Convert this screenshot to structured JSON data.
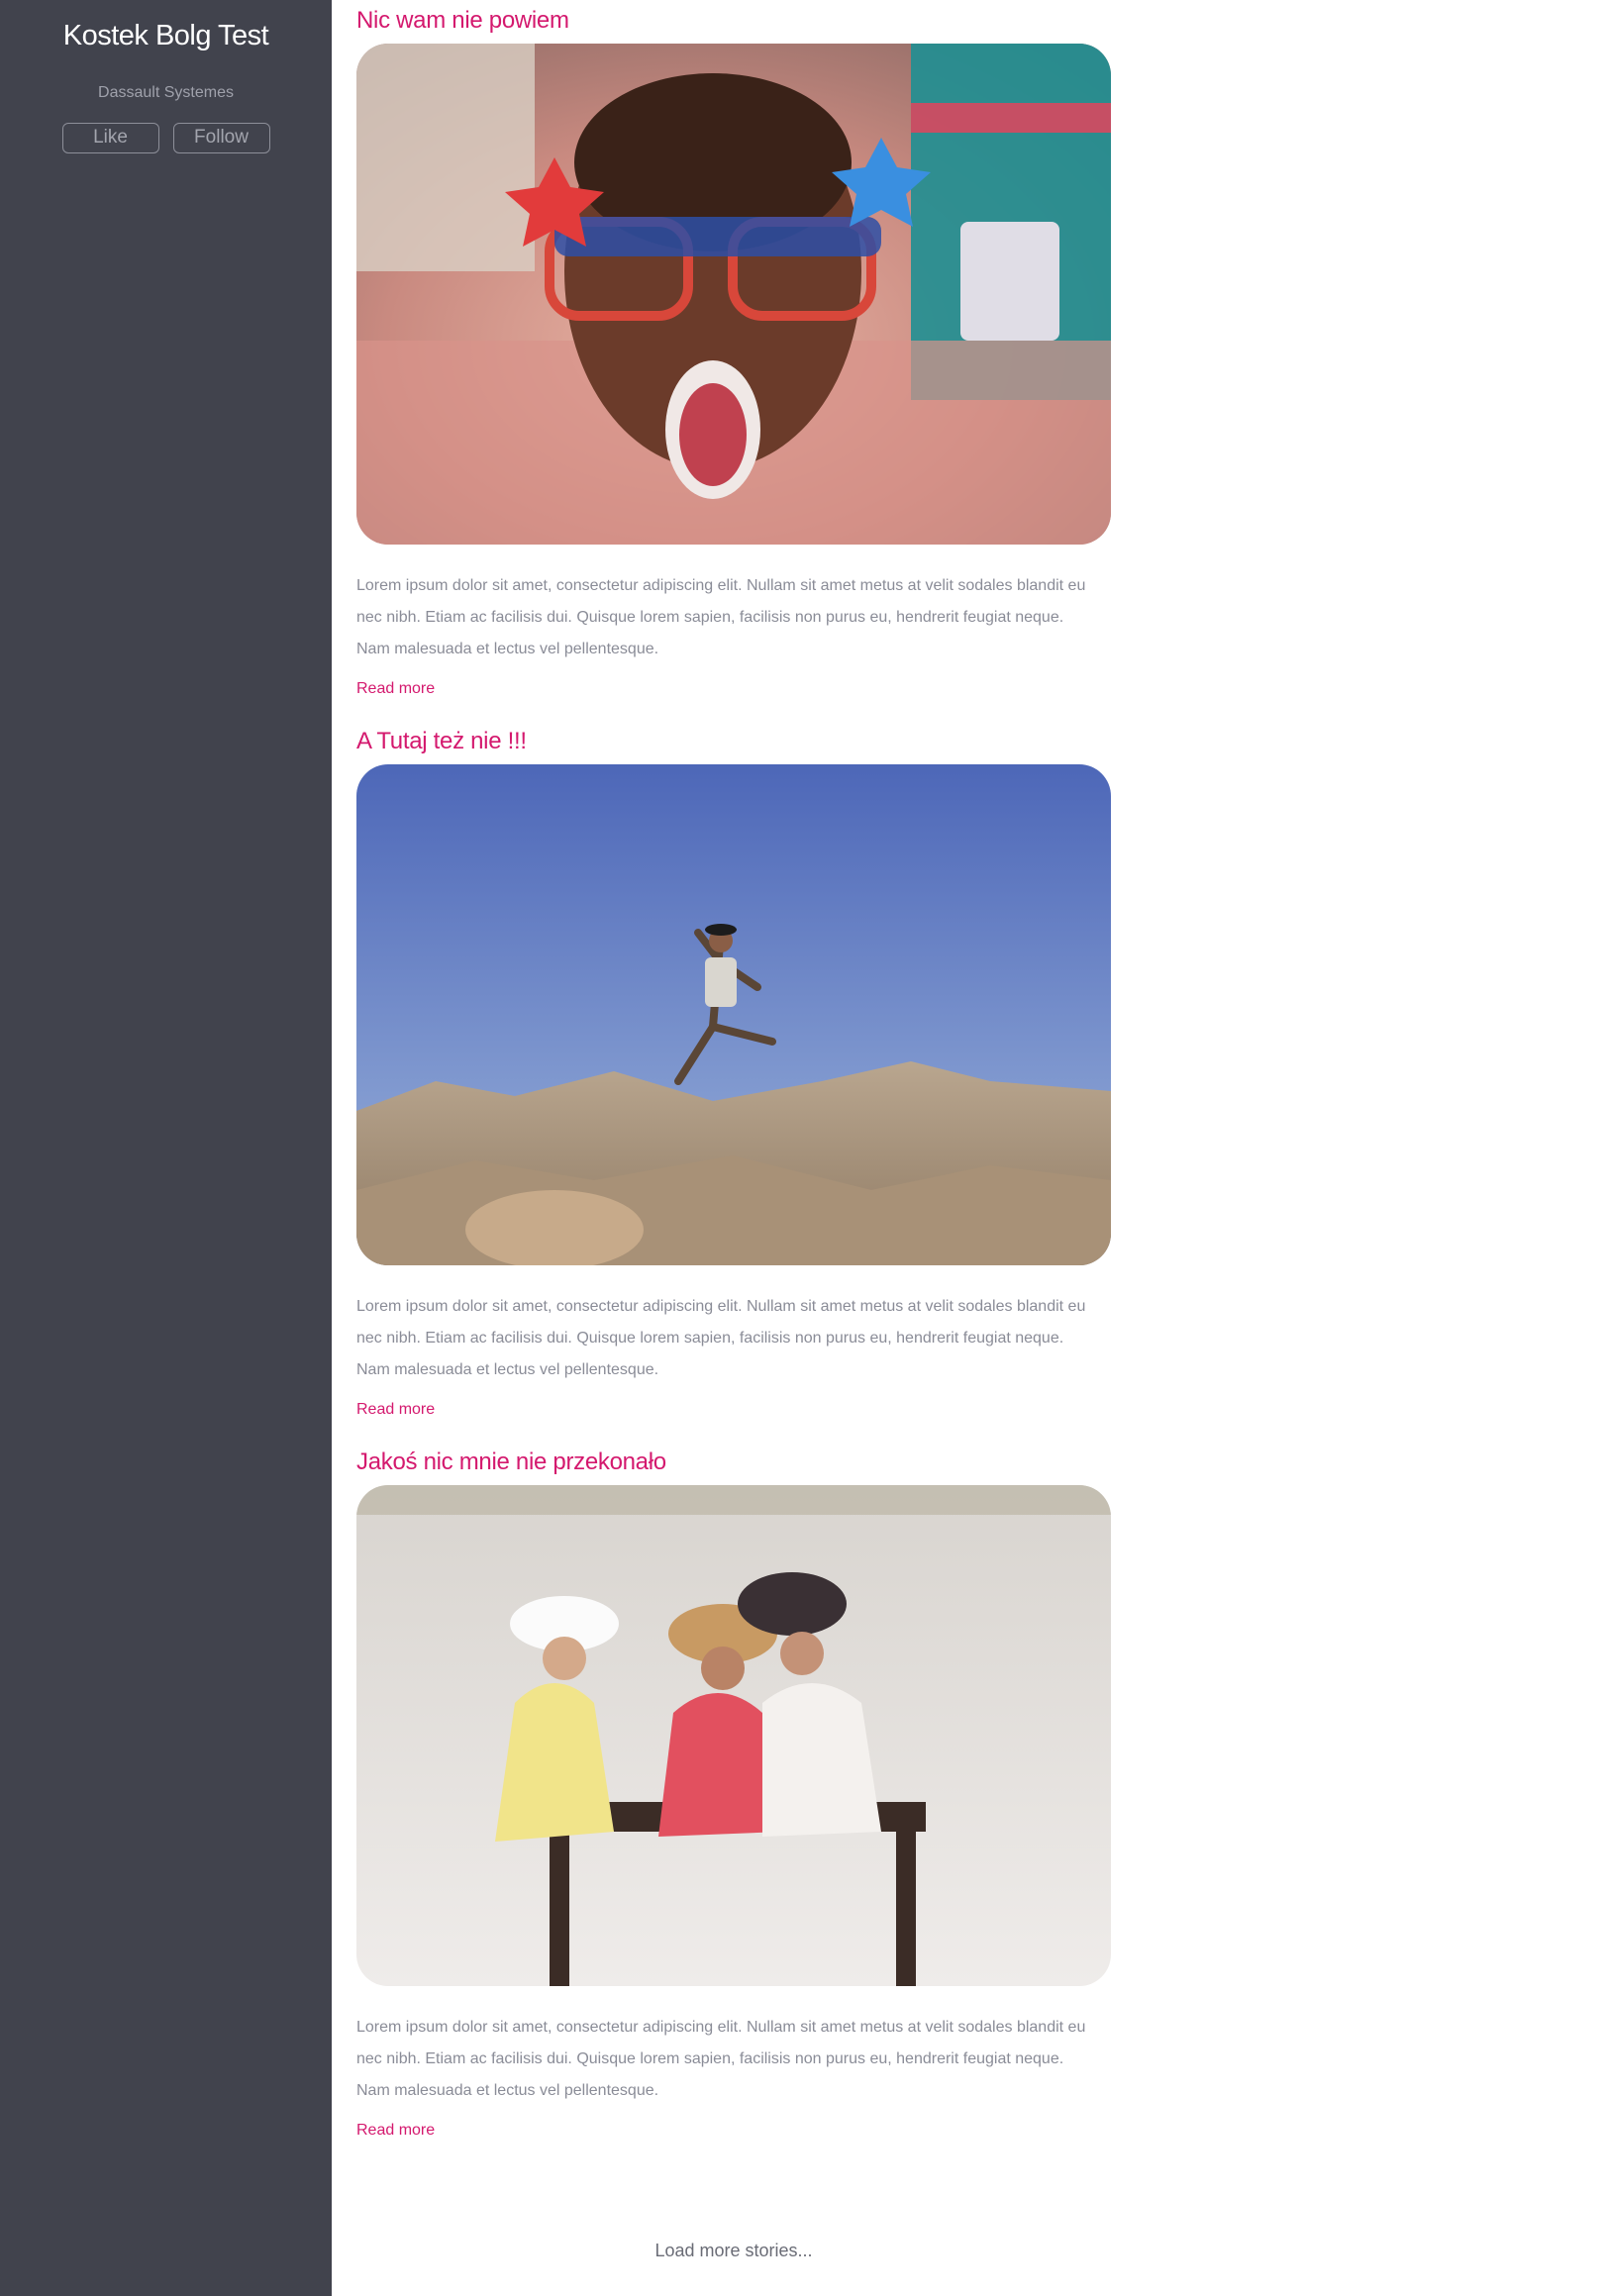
{
  "sidebar": {
    "title": "Kostek Bolg Test",
    "subtitle": "Dassault Systemes",
    "like_label": "Like",
    "follow_label": "Follow"
  },
  "posts": [
    {
      "title": "Nic wam nie powiem",
      "image_alt": "boy-with-star-glasses",
      "excerpt": "Lorem ipsum dolor sit amet, consectetur adipiscing elit. Nullam sit amet metus at velit sodales blandit eu nec nibh. Etiam ac facilisis dui. Quisque lorem sapien, facilisis non purus eu, hendrerit feugiat neque. Nam malesuada et lectus vel pellentesque.",
      "read_more": "Read more"
    },
    {
      "title": "A Tutaj też nie !!!",
      "image_alt": "man-jumping-desert",
      "excerpt": "Lorem ipsum dolor sit amet, consectetur adipiscing elit. Nullam sit amet metus at velit sodales blandit eu nec nibh. Etiam ac facilisis dui. Quisque lorem sapien, facilisis non purus eu, hendrerit feugiat neque. Nam malesuada et lectus vel pellentesque.",
      "read_more": "Read more"
    },
    {
      "title": "Jakoś nic mnie nie przekonało",
      "image_alt": "three-women-bench",
      "excerpt": "Lorem ipsum dolor sit amet, consectetur adipiscing elit. Nullam sit amet metus at velit sodales blandit eu nec nibh. Etiam ac facilisis dui. Quisque lorem sapien, facilisis non purus eu, hendrerit feugiat neque. Nam malesuada et lectus vel pellentesque.",
      "read_more": "Read more"
    }
  ],
  "load_more": "Load more stories...",
  "colors": {
    "sidebar_bg": "#41434d",
    "accent": "#d4196e",
    "text_muted": "#8a8c97"
  }
}
